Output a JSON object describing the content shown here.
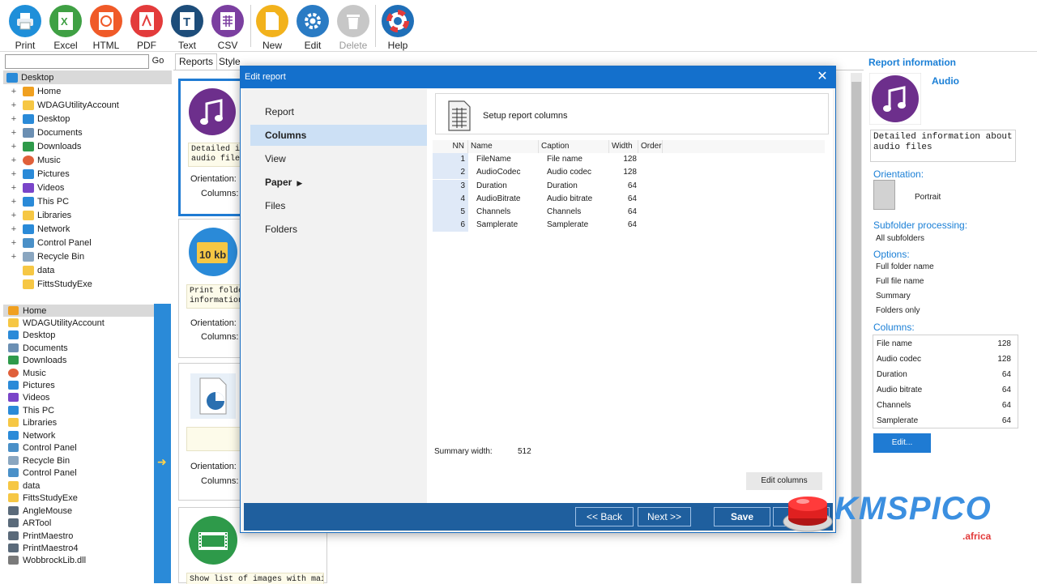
{
  "toolbar": {
    "items": [
      {
        "label": "Print",
        "icon": "printer-icon",
        "color": "#1f8fd9"
      },
      {
        "label": "Excel",
        "icon": "excel-icon",
        "color": "#3fa044"
      },
      {
        "label": "HTML",
        "icon": "html-icon",
        "color": "#f05a28"
      },
      {
        "label": "PDF",
        "icon": "pdf-icon",
        "color": "#e33b3b"
      },
      {
        "label": "Text",
        "icon": "text-icon",
        "color": "#1d4d7a"
      },
      {
        "label": "CSV",
        "icon": "csv-icon",
        "color": "#7b3fa0"
      },
      {
        "label": "New",
        "icon": "new-document-icon",
        "color": "#f2b21c"
      },
      {
        "label": "Edit",
        "icon": "gear-icon",
        "color": "#2a7bc4"
      },
      {
        "label": "Delete",
        "icon": "trash-icon",
        "color": "#c7c7c7"
      },
      {
        "label": "Help",
        "icon": "lifebuoy-icon",
        "color": "#1f6fb8"
      }
    ]
  },
  "search": {
    "value": "",
    "go_label": "Go"
  },
  "tree_top": [
    {
      "label": "Desktop",
      "expander": "",
      "icon_color": "#2a8ad8",
      "selected": true
    },
    {
      "label": "Home",
      "expander": "+",
      "icon_color": "#f0a020"
    },
    {
      "label": "WDAGUtilityAccount",
      "expander": "+",
      "icon_color": "#f6c744"
    },
    {
      "label": "Desktop",
      "expander": "+",
      "icon_color": "#2a8ad8"
    },
    {
      "label": "Documents",
      "expander": "+",
      "icon_color": "#6b8fb3"
    },
    {
      "label": "Downloads",
      "expander": "+",
      "icon_color": "#2e9a4a"
    },
    {
      "label": "Music",
      "expander": "+",
      "icon_color": "#e0603a"
    },
    {
      "label": "Pictures",
      "expander": "+",
      "icon_color": "#2a8ad8"
    },
    {
      "label": "Videos",
      "expander": "+",
      "icon_color": "#7a45c9"
    },
    {
      "label": "This PC",
      "expander": "+",
      "icon_color": "#2a8ad8"
    },
    {
      "label": "Libraries",
      "expander": "+",
      "icon_color": "#f6c744"
    },
    {
      "label": "Network",
      "expander": "+",
      "icon_color": "#2a8ad8"
    },
    {
      "label": "Control Panel",
      "expander": "+",
      "icon_color": "#4a90c8"
    },
    {
      "label": "Recycle Bin",
      "expander": "+",
      "icon_color": "#8aa6c0"
    },
    {
      "label": "data",
      "expander": "",
      "icon_color": "#f6c744"
    },
    {
      "label": "FittsStudyExe",
      "expander": "",
      "icon_color": "#f6c744"
    }
  ],
  "tree_bottom": [
    {
      "label": "Home",
      "icon_color": "#f0a020",
      "selected": true
    },
    {
      "label": "WDAGUtilityAccount",
      "icon_color": "#f6c744"
    },
    {
      "label": "Desktop",
      "icon_color": "#2a8ad8"
    },
    {
      "label": "Documents",
      "icon_color": "#6b8fb3"
    },
    {
      "label": "Downloads",
      "icon_color": "#2e9a4a"
    },
    {
      "label": "Music",
      "icon_color": "#e0603a"
    },
    {
      "label": "Pictures",
      "icon_color": "#2a8ad8"
    },
    {
      "label": "Videos",
      "icon_color": "#7a45c9"
    },
    {
      "label": "This PC",
      "icon_color": "#2a8ad8"
    },
    {
      "label": "Libraries",
      "icon_color": "#f6c744"
    },
    {
      "label": "Network",
      "icon_color": "#2a8ad8"
    },
    {
      "label": "Control Panel",
      "icon_color": "#4a90c8"
    },
    {
      "label": "Recycle Bin",
      "icon_color": "#8aa6c0"
    },
    {
      "label": "Control Panel",
      "icon_color": "#4a90c8"
    },
    {
      "label": "data",
      "icon_color": "#f6c744"
    },
    {
      "label": "FittsStudyExe",
      "icon_color": "#f6c744"
    },
    {
      "label": "AngleMouse",
      "icon_color": "#5a6a7a"
    },
    {
      "label": "ARTool",
      "icon_color": "#5a6a7a"
    },
    {
      "label": "PrintMaestro",
      "icon_color": "#5a6a7a"
    },
    {
      "label": "PrintMaestro4",
      "icon_color": "#5a6a7a"
    },
    {
      "label": "WobbrockLib.dll",
      "icon_color": "#7a7a7a"
    }
  ],
  "tabs": {
    "reports": "Reports",
    "styles": "Style"
  },
  "cards": [
    {
      "desc": "Detailed in\naudio files",
      "orientation_label": "Orientation:",
      "columns_label": "Columns:",
      "icon": "music-note-icon",
      "selected": true
    },
    {
      "desc": "Print folder\ninformation",
      "orientation_label": "Orientation:",
      "columns_label": "Columns:",
      "icon": "folder-size-icon"
    },
    {
      "desc": "",
      "orientation_label": "Orientation:",
      "columns_label": "Columns:",
      "icon": "pie-document-icon"
    },
    {
      "desc": "Show list of images with main",
      "orientation_label": "",
      "columns_label": "",
      "icon": "film-icon"
    }
  ],
  "dialog": {
    "title": "Edit report",
    "nav": [
      {
        "label": "Report"
      },
      {
        "label": "Columns",
        "active": true
      },
      {
        "label": "View"
      },
      {
        "label": "Paper",
        "caret": "▶"
      },
      {
        "label": "Files"
      },
      {
        "label": "Folders"
      }
    ],
    "setup_text": "Setup report columns",
    "grid_headers": {
      "nn": "NN",
      "name": "Name",
      "caption": "Caption",
      "width": "Width",
      "order": "Order"
    },
    "rows": [
      {
        "nn": "1",
        "name": "FileName",
        "caption": "File name",
        "width": "128",
        "order": ""
      },
      {
        "nn": "2",
        "name": "AudioCodec",
        "caption": "Audio codec",
        "width": "128",
        "order": ""
      },
      {
        "nn": "3",
        "name": "Duration",
        "caption": "Duration",
        "width": "64",
        "order": ""
      },
      {
        "nn": "4",
        "name": "AudioBitrate",
        "caption": "Audio bitrate",
        "width": "64",
        "order": ""
      },
      {
        "nn": "5",
        "name": "Channels",
        "caption": "Channels",
        "width": "64",
        "order": ""
      },
      {
        "nn": "6",
        "name": "Samplerate",
        "caption": "Samplerate",
        "width": "64",
        "order": ""
      }
    ],
    "summary_label": "Summary width:",
    "summary_value": "512",
    "edit_columns": "Edit columns",
    "footer": {
      "back": "<< Back",
      "next": "Next >>",
      "save": "Save"
    }
  },
  "info": {
    "title": "Report information",
    "name": "Audio",
    "desc": "Detailed information about\naudio files",
    "orientation_label": "Orientation:",
    "orientation_value": "Portrait",
    "subfolder_label": "Subfolder processing:",
    "subfolder_value": "All subfolders",
    "options_label": "Options:",
    "options": [
      "Full folder name",
      "Full file name",
      "Summary",
      "Folders only"
    ],
    "columns_label": "Columns:",
    "columns": [
      {
        "caption": "File name",
        "width": "128"
      },
      {
        "caption": "Audio codec",
        "width": "128"
      },
      {
        "caption": "Duration",
        "width": "64"
      },
      {
        "caption": "Audio bitrate",
        "width": "64"
      },
      {
        "caption": "Channels",
        "width": "64"
      },
      {
        "caption": "Samplerate",
        "width": "64"
      }
    ],
    "edit_button": "Edit..."
  },
  "watermark": {
    "text": "KMSPICO",
    "sub": ".africa"
  },
  "colors": {
    "accent": "#1f7bd3",
    "dialog_title": "#1470cc",
    "footer": "#1f5f9e",
    "link": "#1a7fd6"
  }
}
